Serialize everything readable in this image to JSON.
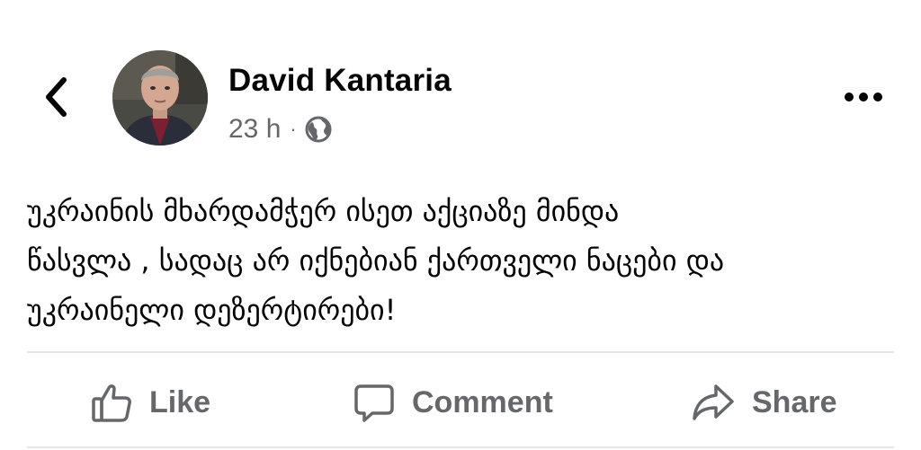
{
  "post": {
    "author": "David Kantaria",
    "timestamp": "23 h",
    "separator": "·",
    "audience_icon": "globe-icon",
    "text": "უკრაინის მხარდამჭერ ისეთ აქციაზე მინდა\nწასვლა , სადაც არ იქნებიან ქართველი ნაცები და\nუკრაინელი დეზერტირები!"
  },
  "actions": {
    "like": "Like",
    "comment": "Comment",
    "share": "Share"
  },
  "icons": {
    "back": "chevron-left-icon",
    "more": "more-horizontal-icon",
    "like": "thumbs-up-icon",
    "comment": "comment-bubble-icon",
    "share": "share-arrow-icon"
  },
  "colors": {
    "text": "#050505",
    "secondary": "#65676b",
    "divider": "#e4e6eb"
  }
}
